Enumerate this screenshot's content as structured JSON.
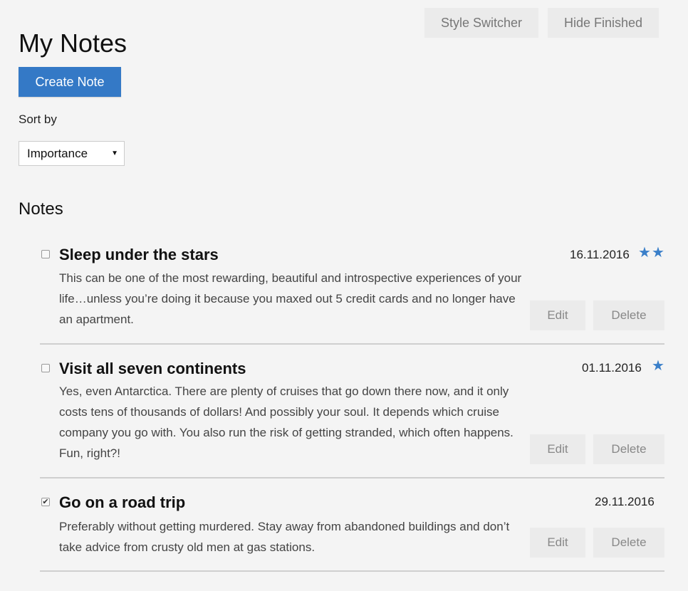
{
  "toolbar": {
    "style_switcher_label": "Style Switcher",
    "hide_finished_label": "Hide Finished"
  },
  "header": {
    "title": "My Notes",
    "create_label": "Create Note"
  },
  "sort": {
    "label": "Sort by",
    "selected": "Importance"
  },
  "notes_section": {
    "title": "Notes",
    "edit_label": "Edit",
    "delete_label": "Delete",
    "items": [
      {
        "title": "Sleep under the stars",
        "description": "This can be one of the most rewarding, beautiful and introspective experiences of your life…unless you’re doing it because you maxed out 5 credit cards and no longer have an apartment.",
        "date": "16.11.2016",
        "importance": 2,
        "finished": false
      },
      {
        "title": "Visit all seven continents",
        "description": "Yes, even Antarctica. There are plenty of cruises that go down there now, and it only costs tens of thousands of dollars! And possibly your soul. It depends which cruise company you go with. You also run the risk of getting stranded, which often happens. Fun, right?!",
        "date": "01.11.2016",
        "importance": 1,
        "finished": false
      },
      {
        "title": "Go on a road trip",
        "description": "Preferably without getting murdered. Stay away from abandoned buildings and don’t take advice from crusty old men at gas stations.",
        "date": "29.11.2016",
        "importance": 0,
        "finished": true
      }
    ]
  },
  "colors": {
    "accent": "#3479c6",
    "star": "#3a7fc9",
    "background": "#f4f4f4"
  },
  "icons": {
    "star": "star-icon",
    "checkbox": "checkbox-icon",
    "caret": "caret-down-icon"
  }
}
